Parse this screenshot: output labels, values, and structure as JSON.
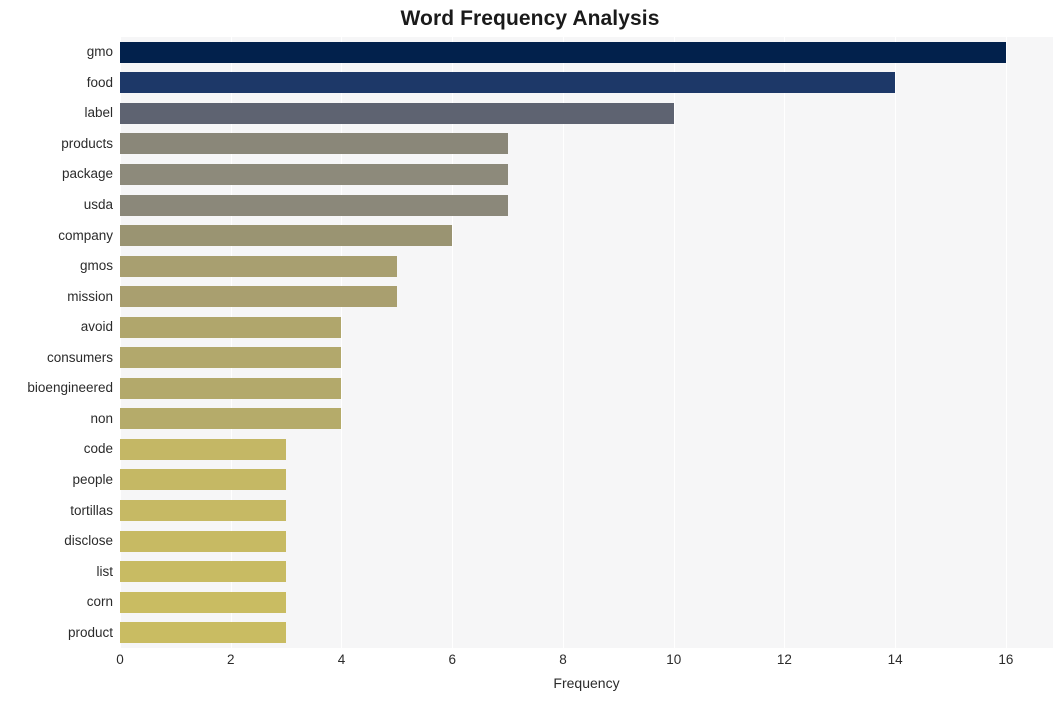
{
  "chart_data": {
    "type": "bar",
    "orientation": "horizontal",
    "title": "Word Frequency Analysis",
    "xlabel": "Frequency",
    "ylabel": "",
    "xlim": [
      0,
      16.85
    ],
    "xticks": [
      0,
      2,
      4,
      6,
      8,
      10,
      12,
      14,
      16
    ],
    "xtick_labels": [
      "0",
      "2",
      "4",
      "6",
      "8",
      "10",
      "12",
      "14",
      "16"
    ],
    "grid": "vertical-white-on-light-gray",
    "legend": "none",
    "categories": [
      "gmo",
      "food",
      "label",
      "products",
      "package",
      "usda",
      "company",
      "gmos",
      "mission",
      "avoid",
      "consumers",
      "bioengineered",
      "non",
      "code",
      "people",
      "tortillas",
      "disclose",
      "list",
      "corn",
      "product"
    ],
    "values": [
      16,
      14,
      10,
      7,
      7,
      7,
      6,
      5,
      5,
      4,
      4,
      4,
      4,
      3,
      3,
      3,
      3,
      3,
      3,
      3
    ],
    "bar_colors": [
      "#02214c",
      "#1d3868",
      "#5e6371",
      "#8a8779",
      "#8d8a7b",
      "#8b887a",
      "#9a9472",
      "#a89f70",
      "#a99f6f",
      "#b0a66c",
      "#b2a86c",
      "#b3a96b",
      "#b5ab6a",
      "#c4b765",
      "#c5b864",
      "#c6b964",
      "#c7ba63",
      "#c8bb63",
      "#c9bc62",
      "#c9bc62"
    ],
    "plot_bg": "#f6f6f7",
    "figure_bg": "#ffffff",
    "title_color": "#1a1a1a",
    "tick_color": "#2b2b2b"
  }
}
